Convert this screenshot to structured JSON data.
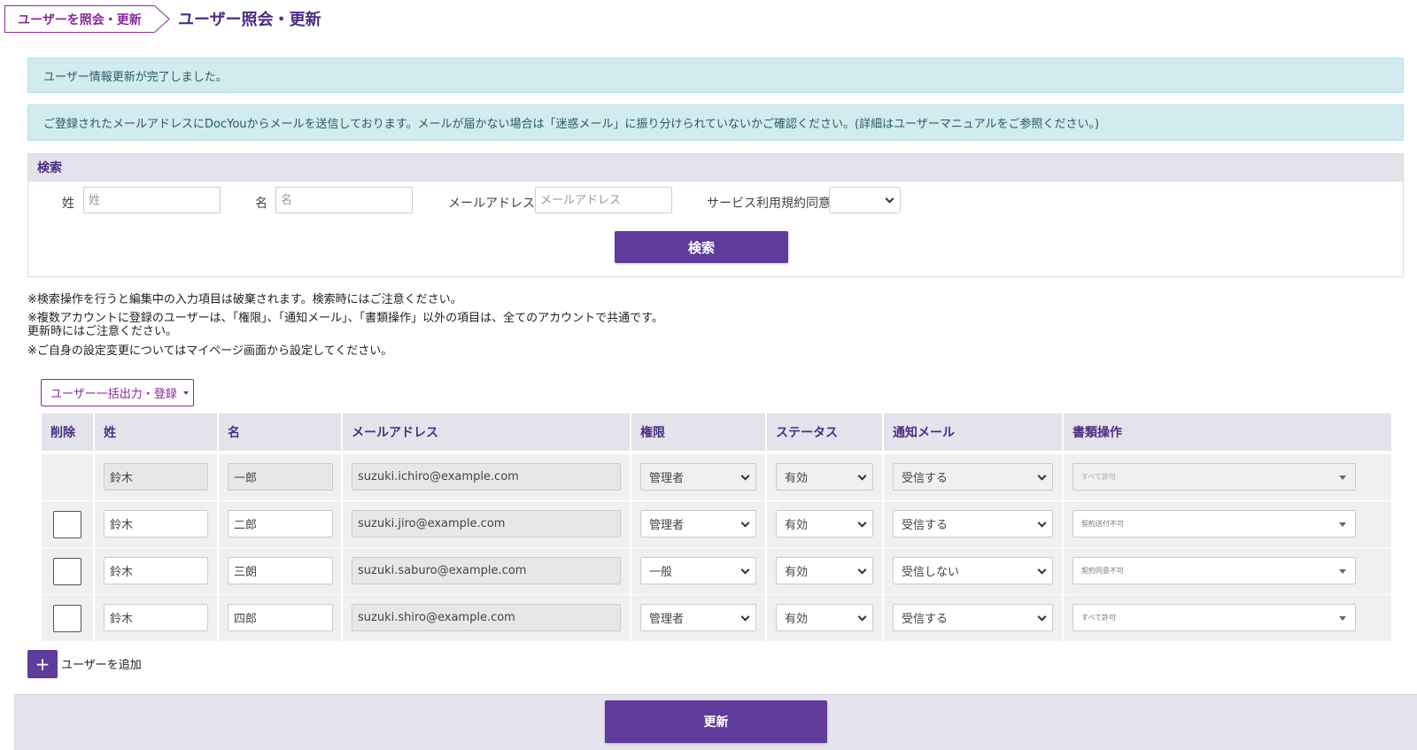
{
  "breadcrumb": {
    "label": "ユーザーを照会・更新"
  },
  "page_title": "ユーザー照会・更新",
  "alerts": {
    "update_complete": "ユーザー情報更新が完了しました。",
    "email_notice": "ご登録されたメールアドレスにDocYouからメールを送信しております。メールが届かない場合は「迷惑メール」に振り分けられていないかご確認ください。(詳細はユーザーマニュアルをご参照ください。)"
  },
  "search": {
    "title": "検索",
    "last_name_label": "姓",
    "last_name_placeholder": "姓",
    "first_name_label": "名",
    "first_name_placeholder": "名",
    "email_label": "メールアドレス",
    "email_placeholder": "メールアドレス",
    "agreement_label": "サービス利用規約同意",
    "agreement_value": "",
    "button": "検索"
  },
  "notes": {
    "line1": "※検索操作を行うと編集中の入力項目は破棄されます。検索時にはご注意ください。",
    "line2": "※複数アカウントに登録のユーザーは、「権限」、「通知メール」、「書類操作」以外の項目は、全てのアカウントで共通です。",
    "line3": "更新時にはご注意ください。",
    "line4": "※ご自身の設定変更についてはマイページ画面から設定してください。"
  },
  "bulk_button": "ユーザー一括出力・登録",
  "table": {
    "headers": {
      "delete": "削除",
      "last_name": "姓",
      "first_name": "名",
      "email": "メールアドレス",
      "role": "権限",
      "status": "ステータス",
      "notify": "通知メール",
      "docs": "書類操作"
    },
    "rows": [
      {
        "last_name": "鈴木",
        "first_name": "一郎",
        "email": "suzuki.ichiro@example.com",
        "role": "管理者",
        "status": "有効",
        "notify": "受信する",
        "docs": "すべて許可"
      },
      {
        "last_name": "鈴木",
        "first_name": "二郎",
        "email": "suzuki.jiro@example.com",
        "role": "管理者",
        "status": "有効",
        "notify": "受信する",
        "docs": "契約送付不可"
      },
      {
        "last_name": "鈴木",
        "first_name": "三朗",
        "email": "suzuki.saburo@example.com",
        "role": "一般",
        "status": "有効",
        "notify": "受信しない",
        "docs": "契約同意不可"
      },
      {
        "last_name": "鈴木",
        "first_name": "四郎",
        "email": "suzuki.shiro@example.com",
        "role": "管理者",
        "status": "有効",
        "notify": "受信する",
        "docs": "すべて許可"
      }
    ]
  },
  "add_user": {
    "icon": "+",
    "label": "ユーザーを追加"
  },
  "update_button": "更新",
  "colors": {
    "primary": "#5f3b9c",
    "accent": "#8a2a9b",
    "alert_bg": "#d2ebef"
  }
}
